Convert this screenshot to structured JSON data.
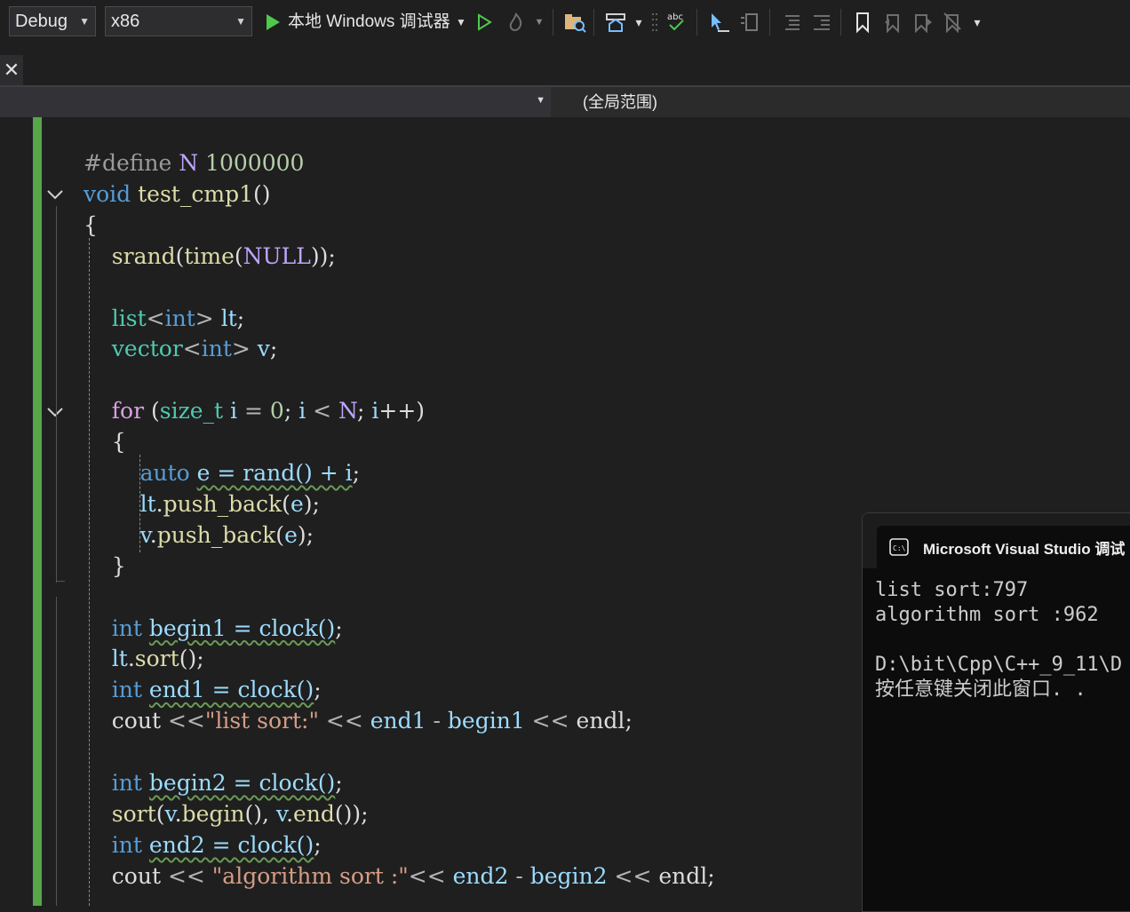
{
  "toolbar": {
    "config": "Debug",
    "platform": "x86",
    "run_target": "本地 Windows 调试器"
  },
  "navbar": {
    "scope": "(全局范围)"
  },
  "code": [
    [
      {
        "t": "#define ",
        "c": "pp"
      },
      {
        "t": "N",
        "c": "mac"
      },
      {
        "t": " ",
        "c": ""
      },
      {
        "t": "1000000",
        "c": "num"
      }
    ],
    [
      {
        "t": "void",
        "c": "kw"
      },
      {
        "t": " ",
        "c": ""
      },
      {
        "t": "test_cmp1",
        "c": "fn"
      },
      {
        "t": "()",
        "c": ""
      }
    ],
    [
      {
        "t": "{",
        "c": ""
      }
    ],
    [
      {
        "t": "    ",
        "c": ""
      },
      {
        "t": "srand",
        "c": "fn"
      },
      {
        "t": "(",
        "c": ""
      },
      {
        "t": "time",
        "c": "fn"
      },
      {
        "t": "(",
        "c": ""
      },
      {
        "t": "NULL",
        "c": "mac"
      },
      {
        "t": "));",
        "c": ""
      }
    ],
    [],
    [
      {
        "t": "    ",
        "c": ""
      },
      {
        "t": "list",
        "c": "typ"
      },
      {
        "t": "<",
        "c": "op"
      },
      {
        "t": "int",
        "c": "kw"
      },
      {
        "t": "> ",
        "c": "op"
      },
      {
        "t": "lt",
        "c": "var"
      },
      {
        "t": ";",
        "c": ""
      }
    ],
    [
      {
        "t": "    ",
        "c": ""
      },
      {
        "t": "vector",
        "c": "typ"
      },
      {
        "t": "<",
        "c": "op"
      },
      {
        "t": "int",
        "c": "kw"
      },
      {
        "t": "> ",
        "c": "op"
      },
      {
        "t": "v",
        "c": "var"
      },
      {
        "t": ";",
        "c": ""
      }
    ],
    [],
    [
      {
        "t": "    ",
        "c": ""
      },
      {
        "t": "for",
        "c": "ctl"
      },
      {
        "t": " (",
        "c": ""
      },
      {
        "t": "size_t",
        "c": "typ"
      },
      {
        "t": " ",
        "c": ""
      },
      {
        "t": "i",
        "c": "var"
      },
      {
        "t": " = ",
        "c": "op"
      },
      {
        "t": "0",
        "c": "num"
      },
      {
        "t": "; ",
        "c": ""
      },
      {
        "t": "i",
        "c": "var"
      },
      {
        "t": " < ",
        "c": "op"
      },
      {
        "t": "N",
        "c": "mac"
      },
      {
        "t": "; ",
        "c": ""
      },
      {
        "t": "i",
        "c": "var"
      },
      {
        "t": "++)",
        "c": ""
      }
    ],
    [
      {
        "t": "    {",
        "c": ""
      }
    ],
    [
      {
        "t": "        ",
        "c": ""
      },
      {
        "t": "auto",
        "c": "kw"
      },
      {
        "t": " ",
        "c": ""
      },
      {
        "t": "e = rand() + i",
        "c": "var sq"
      },
      {
        "t": ";",
        "c": ""
      }
    ],
    [
      {
        "t": "        ",
        "c": ""
      },
      {
        "t": "lt",
        "c": "var"
      },
      {
        "t": ".",
        "c": ""
      },
      {
        "t": "push_back",
        "c": "fn"
      },
      {
        "t": "(",
        "c": ""
      },
      {
        "t": "e",
        "c": "var"
      },
      {
        "t": ");",
        "c": ""
      }
    ],
    [
      {
        "t": "        ",
        "c": ""
      },
      {
        "t": "v",
        "c": "var"
      },
      {
        "t": ".",
        "c": ""
      },
      {
        "t": "push_back",
        "c": "fn"
      },
      {
        "t": "(",
        "c": ""
      },
      {
        "t": "e",
        "c": "var"
      },
      {
        "t": ");",
        "c": ""
      }
    ],
    [
      {
        "t": "    }",
        "c": ""
      }
    ],
    [],
    [
      {
        "t": "    ",
        "c": ""
      },
      {
        "t": "int",
        "c": "kw"
      },
      {
        "t": " ",
        "c": ""
      },
      {
        "t": "begin1 = clock()",
        "c": "var sq"
      },
      {
        "t": ";",
        "c": ""
      }
    ],
    [
      {
        "t": "    ",
        "c": ""
      },
      {
        "t": "lt",
        "c": "var"
      },
      {
        "t": ".",
        "c": ""
      },
      {
        "t": "sort",
        "c": "fn"
      },
      {
        "t": "();",
        "c": ""
      }
    ],
    [
      {
        "t": "    ",
        "c": ""
      },
      {
        "t": "int",
        "c": "kw"
      },
      {
        "t": " ",
        "c": ""
      },
      {
        "t": "end1 = clock()",
        "c": "var sq"
      },
      {
        "t": ";",
        "c": ""
      }
    ],
    [
      {
        "t": "    ",
        "c": ""
      },
      {
        "t": "cout",
        "c": ""
      },
      {
        "t": " <<",
        "c": "op"
      },
      {
        "t": "\"list sort:\"",
        "c": "str"
      },
      {
        "t": " << ",
        "c": "op"
      },
      {
        "t": "end1",
        "c": "var"
      },
      {
        "t": " - ",
        "c": "op"
      },
      {
        "t": "begin1",
        "c": "var"
      },
      {
        "t": " << ",
        "c": "op"
      },
      {
        "t": "endl",
        "c": ""
      },
      {
        "t": ";",
        "c": ""
      }
    ],
    [],
    [
      {
        "t": "    ",
        "c": ""
      },
      {
        "t": "int",
        "c": "kw"
      },
      {
        "t": " ",
        "c": ""
      },
      {
        "t": "begin2 = clock()",
        "c": "var sq"
      },
      {
        "t": ";",
        "c": ""
      }
    ],
    [
      {
        "t": "    ",
        "c": ""
      },
      {
        "t": "sort",
        "c": "fn"
      },
      {
        "t": "(",
        "c": ""
      },
      {
        "t": "v",
        "c": "var"
      },
      {
        "t": ".",
        "c": ""
      },
      {
        "t": "begin",
        "c": "fn"
      },
      {
        "t": "(), ",
        "c": ""
      },
      {
        "t": "v",
        "c": "var"
      },
      {
        "t": ".",
        "c": ""
      },
      {
        "t": "end",
        "c": "fn"
      },
      {
        "t": "());",
        "c": ""
      }
    ],
    [
      {
        "t": "    ",
        "c": ""
      },
      {
        "t": "int",
        "c": "kw"
      },
      {
        "t": " ",
        "c": ""
      },
      {
        "t": "end2 = clock()",
        "c": "var sq"
      },
      {
        "t": ";",
        "c": ""
      }
    ],
    [
      {
        "t": "    ",
        "c": ""
      },
      {
        "t": "cout",
        "c": ""
      },
      {
        "t": " << ",
        "c": "op"
      },
      {
        "t": "\"algorithm sort :\"",
        "c": "str"
      },
      {
        "t": "<< ",
        "c": "op"
      },
      {
        "t": "end2",
        "c": "var"
      },
      {
        "t": " - ",
        "c": "op"
      },
      {
        "t": "begin2",
        "c": "var"
      },
      {
        "t": " << ",
        "c": "op"
      },
      {
        "t": "endl",
        "c": ""
      },
      {
        "t": ";",
        "c": ""
      }
    ]
  ],
  "console": {
    "title": "Microsoft Visual Studio 调试",
    "lines": [
      "list sort:797",
      "algorithm sort :962",
      "",
      "D:\\bit\\Cpp\\C++_9_11\\D",
      "按任意键关闭此窗口. ."
    ]
  }
}
